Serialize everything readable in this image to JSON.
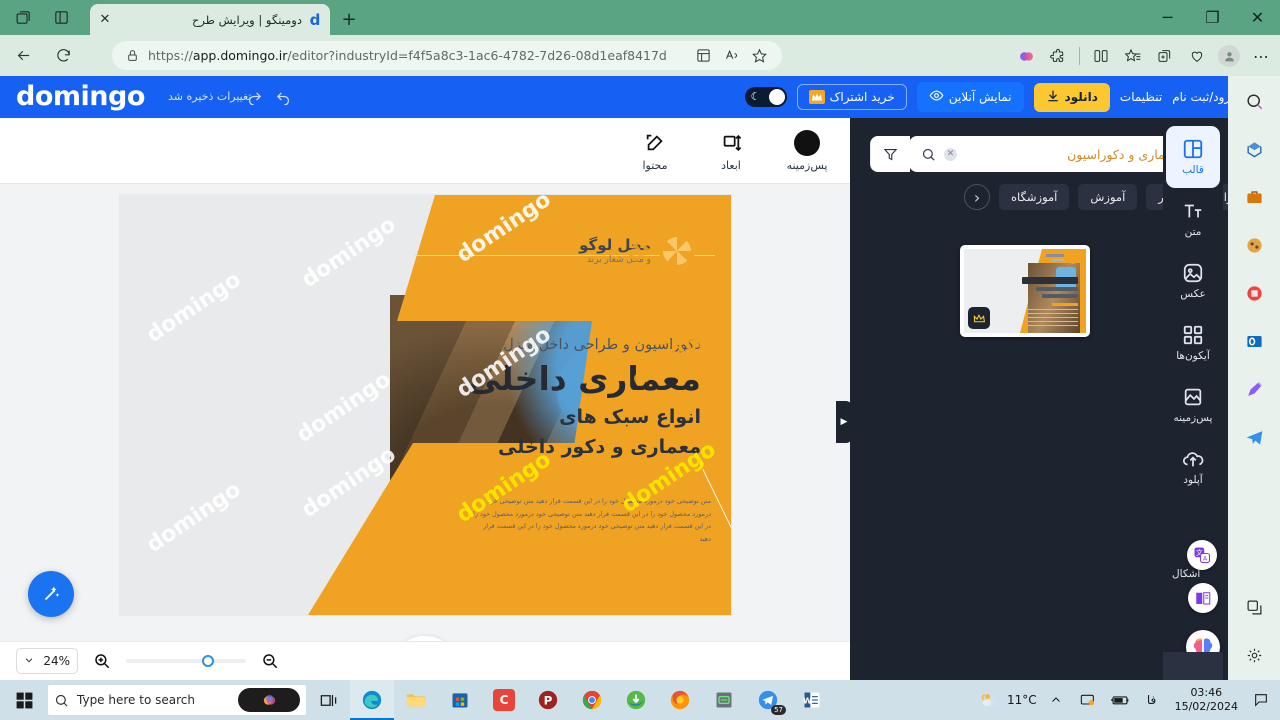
{
  "browser": {
    "tab": {
      "title": "دومینگو | ویرایش طرح",
      "favicon_letter": "d",
      "close_label": "✕"
    },
    "new_tab_label": "+",
    "url_prefix": "https://",
    "url_bold": "app.domingo.ir",
    "url_rest": "/editor?industryId=f4f5a8c3-1ac6-4782-7d26-08d1eaf8417d",
    "window_controls": {
      "minimize": "─",
      "maximize": "❐",
      "close": "✕"
    }
  },
  "app_header": {
    "logo": "domingo",
    "saved_text": "تغییرات ذخیره شد",
    "buy_subscription": "خرید اشتراک",
    "online_preview": "نمایش آنلاین",
    "download": "دانلود",
    "settings": "تنظیمات",
    "login_register": "ورود/ثبت نام"
  },
  "left_toolbar": {
    "items": [
      {
        "label": "پس‌زمینه",
        "icon": "black-circle-icon"
      },
      {
        "label": "ابعاد",
        "icon": "resize-icon"
      },
      {
        "label": "محتوا",
        "icon": "edit-pencil-icon"
      }
    ]
  },
  "design": {
    "logo_title": "محل لوگو",
    "logo_sub": "و محل شعار برند",
    "kicker": "دکوراسیون و طراحی داخل منزل",
    "title": "معماری داخلی",
    "sub_line1": "انواع سبک های",
    "sub_line2": "معماری و دکور داخلی",
    "body": "متن توضیحی خود درمورد محصول خود را در این قسمت قرار دهید متن توضیحی خود درمورد محصول خود را در این قسمت قرار دهید متن توضیحی خود درمورد محصول خود را در این قسمت قرار دهید متن توضیحی خود درمورد محصول خود را در این قسمت قرار دهید",
    "watermark": "domingo",
    "colors": {
      "orange": "#f0a322",
      "bg": "#e8eaec",
      "title": "#262b33"
    }
  },
  "zoom_bar": {
    "level": "24%",
    "zoom_in": "zoom-in-icon",
    "zoom_out": "zoom-out-icon"
  },
  "right_panel": {
    "search_value": "معماری و دکوراسیون",
    "filter_label": "filter-icon",
    "chips": [
      "کنفرانس",
      "کار",
      "آموزش",
      "آموزشگاه"
    ],
    "nav_prev": "‹",
    "template_card": {
      "logo_text": "محل لوگو",
      "title": "معماری داخلی",
      "line1": "انواع سبک های",
      "line2": "معماری و دکور داخلی",
      "badge": "premium-crown"
    }
  },
  "rail": {
    "items": [
      {
        "label": "قالب",
        "icon": "template-icon",
        "active": true
      },
      {
        "label": "متن",
        "icon": "text-icon",
        "active": false
      },
      {
        "label": "عکس",
        "icon": "image-icon",
        "active": false
      },
      {
        "label": "آیکون‌ها",
        "icon": "grid-icon",
        "active": false
      },
      {
        "label": "پس‌زمینه",
        "icon": "background-icon",
        "active": false
      },
      {
        "label": "آپلود",
        "icon": "upload-cloud-icon",
        "active": false
      }
    ],
    "shapes_label": "اشکال"
  },
  "taskbar": {
    "search_placeholder": "Type here to search",
    "temperature": "11°C",
    "language": "فا",
    "time": "03:46",
    "date": "15/02/2024",
    "telegram_badge": "57"
  }
}
